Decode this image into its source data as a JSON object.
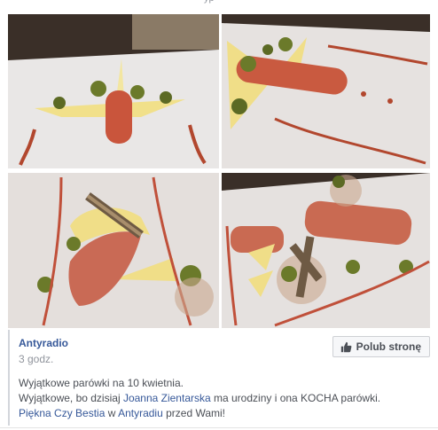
{
  "top_fragment": "yp",
  "photos": [
    {
      "name": "photo-1"
    },
    {
      "name": "photo-2"
    },
    {
      "name": "photo-3"
    },
    {
      "name": "photo-4"
    }
  ],
  "post": {
    "page_name": "Antyradio",
    "time": "3 godz.",
    "like_button": "Polub stronę",
    "line1": "Wyjątkowe parówki na 10 kwietnia.",
    "line2_a": "Wyjątkowe, bo dzisiaj ",
    "line2_link": "Joanna Zientarska",
    "line2_b": " ma urodziny i ona KOCHA parówki.",
    "line3_link1": "Piękna Czy Bestia",
    "line3_mid": " w ",
    "line3_link2": "Antyradiu",
    "line3_b": " przed Wami!"
  },
  "colors": {
    "link": "#365899",
    "meta": "#90949c",
    "text": "#4b4f56"
  }
}
